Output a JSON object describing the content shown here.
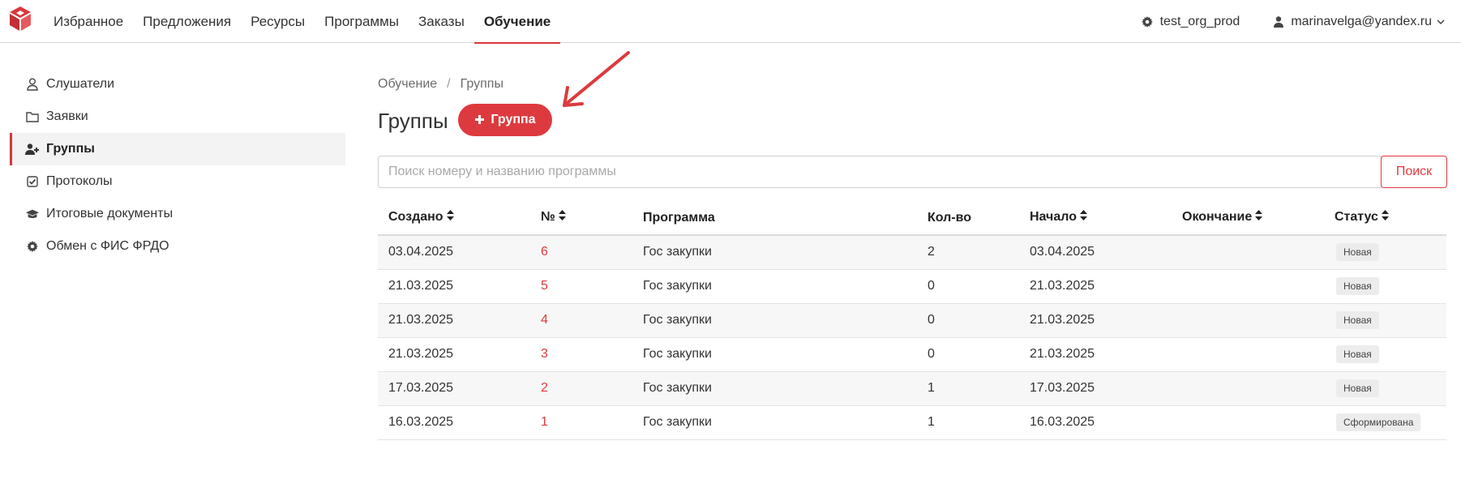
{
  "nav": {
    "items": [
      {
        "label": "Избранное",
        "active": false
      },
      {
        "label": "Предложения",
        "active": false
      },
      {
        "label": "Ресурсы",
        "active": false
      },
      {
        "label": "Программы",
        "active": false
      },
      {
        "label": "Заказы",
        "active": false
      },
      {
        "label": "Обучение",
        "active": true
      }
    ],
    "org_name": "test_org_prod",
    "user_email": "marinavelga@yandex.ru"
  },
  "sidebar": {
    "items": [
      {
        "label": "Слушатели",
        "icon": "user-outline-icon",
        "active": false
      },
      {
        "label": "Заявки",
        "icon": "folder-icon",
        "active": false
      },
      {
        "label": "Группы",
        "icon": "user-plus-icon",
        "active": true
      },
      {
        "label": "Протоколы",
        "icon": "check-square-icon",
        "active": false
      },
      {
        "label": "Итоговые документы",
        "icon": "graduation-cap-icon",
        "active": false
      },
      {
        "label": "Обмен с ФИС ФРДО",
        "icon": "gear-icon",
        "active": false
      }
    ]
  },
  "breadcrumb": {
    "parent": "Обучение",
    "separator": "/",
    "current": "Группы"
  },
  "page": {
    "title": "Группы",
    "add_button_label": "Группа",
    "search_placeholder": "Поиск номеру и названию программы",
    "search_button_label": "Поиск"
  },
  "table": {
    "columns": [
      "Создано",
      "№",
      "Программа",
      "Кол-во",
      "Начало",
      "Окончание",
      "Статус"
    ],
    "rows": [
      {
        "created": "03.04.2025",
        "number": "6",
        "program": "Гос закупки",
        "count": "2",
        "start": "03.04.2025",
        "end": "",
        "status": "Новая"
      },
      {
        "created": "21.03.2025",
        "number": "5",
        "program": "Гос закупки",
        "count": "0",
        "start": "21.03.2025",
        "end": "",
        "status": "Новая"
      },
      {
        "created": "21.03.2025",
        "number": "4",
        "program": "Гос закупки",
        "count": "0",
        "start": "21.03.2025",
        "end": "",
        "status": "Новая"
      },
      {
        "created": "21.03.2025",
        "number": "3",
        "program": "Гос закупки",
        "count": "0",
        "start": "21.03.2025",
        "end": "",
        "status": "Новая"
      },
      {
        "created": "17.03.2025",
        "number": "2",
        "program": "Гос закупки",
        "count": "1",
        "start": "17.03.2025",
        "end": "",
        "status": "Новая"
      },
      {
        "created": "16.03.2025",
        "number": "1",
        "program": "Гос закупки",
        "count": "1",
        "start": "16.03.2025",
        "end": "",
        "status": "Сформирована"
      }
    ]
  },
  "colors": {
    "accent": "#dc3a3e",
    "logo": "#d9373d"
  }
}
